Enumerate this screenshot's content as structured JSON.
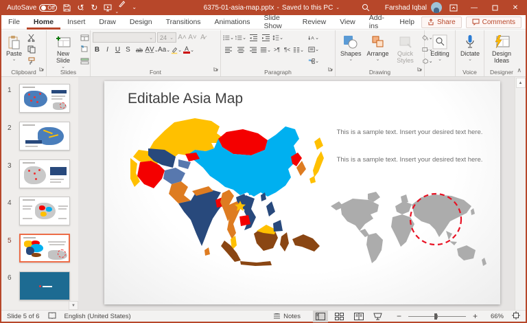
{
  "title_bar": {
    "autosave_label": "AutoSave",
    "autosave_state": "Off",
    "document_title": "6375-01-asia-map.pptx",
    "separator": "-",
    "save_status": "Saved to this PC",
    "user_name": "Farshad Iqbal"
  },
  "tabs": {
    "items": [
      "File",
      "Home",
      "Insert",
      "Draw",
      "Design",
      "Transitions",
      "Animations",
      "Slide Show",
      "Review",
      "View",
      "Add-ins",
      "Help"
    ],
    "active": "Home",
    "share": "Share",
    "comments": "Comments"
  },
  "ribbon": {
    "paste": "Paste",
    "new_slide": "New Slide",
    "font_size": "24",
    "shapes": "Shapes",
    "arrange": "Arrange",
    "quick_styles": "Quick Styles",
    "editing": "Editing",
    "dictate": "Dictate",
    "design_ideas": "Design Ideas",
    "groups": {
      "clipboard": "Clipboard",
      "slides": "Slides",
      "font": "Font",
      "paragraph": "Paragraph",
      "drawing": "Drawing",
      "voice": "Voice",
      "designer": "Designer"
    }
  },
  "thumbnails": [
    {
      "number": "1"
    },
    {
      "number": "2"
    },
    {
      "number": "3"
    },
    {
      "number": "4"
    },
    {
      "number": "5",
      "active": true
    },
    {
      "number": "6"
    }
  ],
  "slide": {
    "title": "Editable Asia Map",
    "sample_text_1": "This is a sample text. Insert your desired text here.",
    "sample_text_2": "This is a sample text. Insert your desired text here."
  },
  "asia_map": {
    "colors": {
      "yellow": "#FFC000",
      "red": "#F40000",
      "light_blue": "#00B0F0",
      "navy": "#28497C",
      "steel_blue": "#5878AE",
      "orange": "#DE7C21",
      "brown": "#8A4613"
    },
    "star_color": "#FFC000",
    "world_map_color": "#ACACAC",
    "highlight_circle_color": "#E81123"
  },
  "status_bar": {
    "slide_indicator": "Slide 5 of 6",
    "language": "English (United States)",
    "notes": "Notes",
    "zoom": "66%"
  }
}
